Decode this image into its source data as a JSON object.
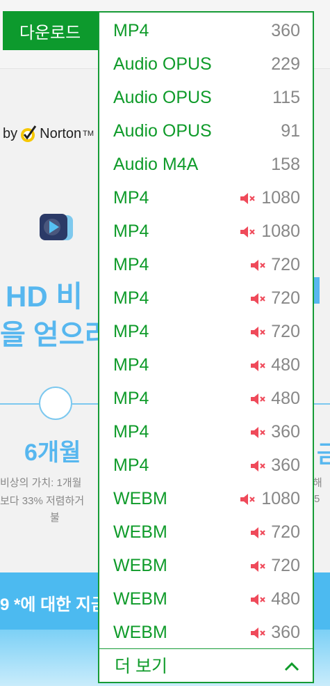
{
  "header": {
    "download_label": "다운로드"
  },
  "norton": {
    "by": "by",
    "name": "Norton",
    "tm": "TM"
  },
  "hero": {
    "line1": "HD 비",
    "line2": "을 얻으리"
  },
  "plan": {
    "label": "6개월",
    "label_right": "금",
    "desc_line1": "비상의 가치: 1개월",
    "desc_line2": "보다 33% 저렴하거",
    "desc_line3": "불",
    "desc_right1": "해",
    "desc_right2": "5"
  },
  "banner": {
    "text": "9 *에 대한 지금"
  },
  "dropdown": {
    "options": [
      {
        "format": "MP4",
        "quality": "360",
        "muted": false
      },
      {
        "format": "Audio OPUS",
        "quality": "229",
        "muted": false
      },
      {
        "format": "Audio OPUS",
        "quality": "115",
        "muted": false
      },
      {
        "format": "Audio OPUS",
        "quality": "91",
        "muted": false
      },
      {
        "format": "Audio M4A",
        "quality": "158",
        "muted": false
      },
      {
        "format": "MP4",
        "quality": "1080",
        "muted": true
      },
      {
        "format": "MP4",
        "quality": "1080",
        "muted": true
      },
      {
        "format": "MP4",
        "quality": "720",
        "muted": true
      },
      {
        "format": "MP4",
        "quality": "720",
        "muted": true
      },
      {
        "format": "MP4",
        "quality": "720",
        "muted": true
      },
      {
        "format": "MP4",
        "quality": "480",
        "muted": true
      },
      {
        "format": "MP4",
        "quality": "480",
        "muted": true
      },
      {
        "format": "MP4",
        "quality": "360",
        "muted": true
      },
      {
        "format": "MP4",
        "quality": "360",
        "muted": true
      },
      {
        "format": "WEBM",
        "quality": "1080",
        "muted": true
      },
      {
        "format": "WEBM",
        "quality": "720",
        "muted": true
      },
      {
        "format": "WEBM",
        "quality": "720",
        "muted": true
      },
      {
        "format": "WEBM",
        "quality": "480",
        "muted": true
      },
      {
        "format": "WEBM",
        "quality": "360",
        "muted": true
      }
    ],
    "more_label": "더 보기"
  },
  "colors": {
    "accent_green": "#0f9b2a",
    "mute_red": "#ef4a5a",
    "hero_blue": "#57b7ef"
  },
  "icons": {
    "mute": "speaker-muted-icon",
    "chevron": "chevron-up-icon",
    "norton": "norton-check-icon",
    "app": "play-logo-icon"
  }
}
